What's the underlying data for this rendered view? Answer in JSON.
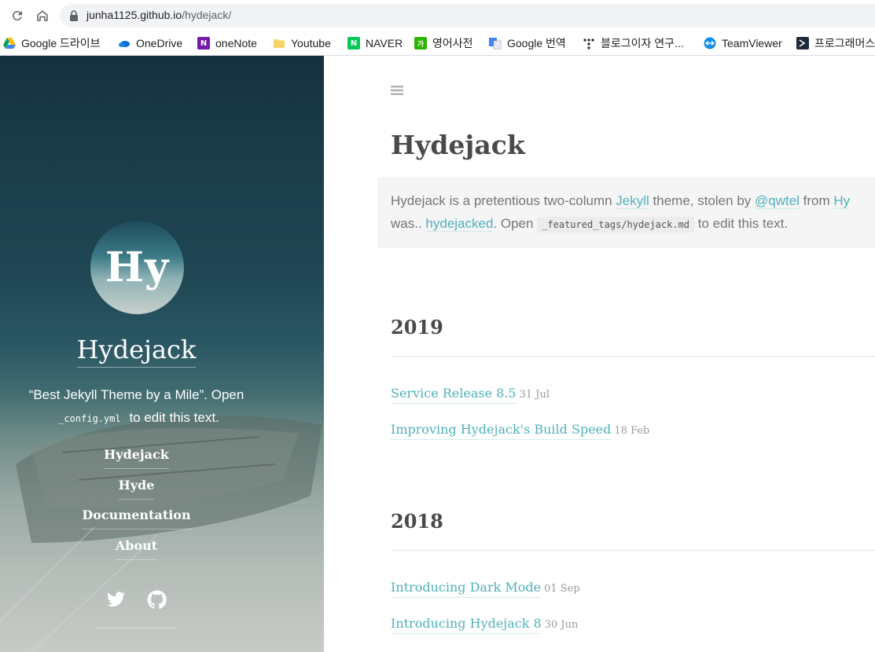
{
  "browser": {
    "url_host": "junha1125.github.io",
    "url_path": "/hydejack/",
    "bookmarks": [
      {
        "label": "Google 드라이브",
        "icon": "google-drive-icon"
      },
      {
        "label": "OneDrive",
        "icon": "onedrive-icon"
      },
      {
        "label": "oneNote",
        "icon": "onenote-icon"
      },
      {
        "label": "Youtube",
        "icon": "folder-icon"
      },
      {
        "label": "NAVER",
        "icon": "naver-icon"
      },
      {
        "label": "영어사전",
        "icon": "dictionary-icon"
      },
      {
        "label": "Google 번역",
        "icon": "google-translate-icon"
      },
      {
        "label": "블로그이자 연구...",
        "icon": "dots-icon"
      },
      {
        "label": "TeamViewer",
        "icon": "teamviewer-icon"
      },
      {
        "label": "프로그래머스",
        "icon": "programmers-icon"
      }
    ],
    "icon_badges": {
      "onenote": "N",
      "naver": "N",
      "dictionary": "가"
    }
  },
  "sidebar": {
    "avatar_text": "Hy",
    "title": "Hydejack",
    "tagline_1": "“Best Jekyll Theme by a Mile”. Open",
    "tagline_code": "_config.yml",
    "tagline_2": "to edit this text.",
    "nav": [
      {
        "label": "Hydejack"
      },
      {
        "label": "Hyde"
      },
      {
        "label": "Documentation"
      },
      {
        "label": "About"
      }
    ],
    "social": [
      "twitter-icon",
      "github-icon"
    ]
  },
  "main": {
    "title": "Hydejack",
    "message": {
      "t1": "Hydejack is a pretentious two-column ",
      "link1": "Jekyll",
      "t2": " theme, stolen by ",
      "link2": "@qwtel",
      "t3": " from ",
      "link3": "Hy",
      "t4": "was.. ",
      "link4": "hydejacked",
      "t5": ". Open ",
      "code": "_featured_tags/hydejack.md",
      "t6": " to edit this text."
    },
    "years": [
      {
        "year": "2019",
        "posts": [
          {
            "title": "Service Release 8.5",
            "date": "31 Jul"
          },
          {
            "title": "Improving Hydejack's Build Speed",
            "date": "18 Feb"
          }
        ]
      },
      {
        "year": "2018",
        "posts": [
          {
            "title": "Introducing Dark Mode",
            "date": "01 Sep"
          },
          {
            "title": "Introducing Hydejack 8",
            "date": "30 Jun"
          }
        ]
      }
    ]
  },
  "colors": {
    "link": "#4fb1ba",
    "heading": "#4a4a4a",
    "sidebar_dark": "#14323e"
  }
}
